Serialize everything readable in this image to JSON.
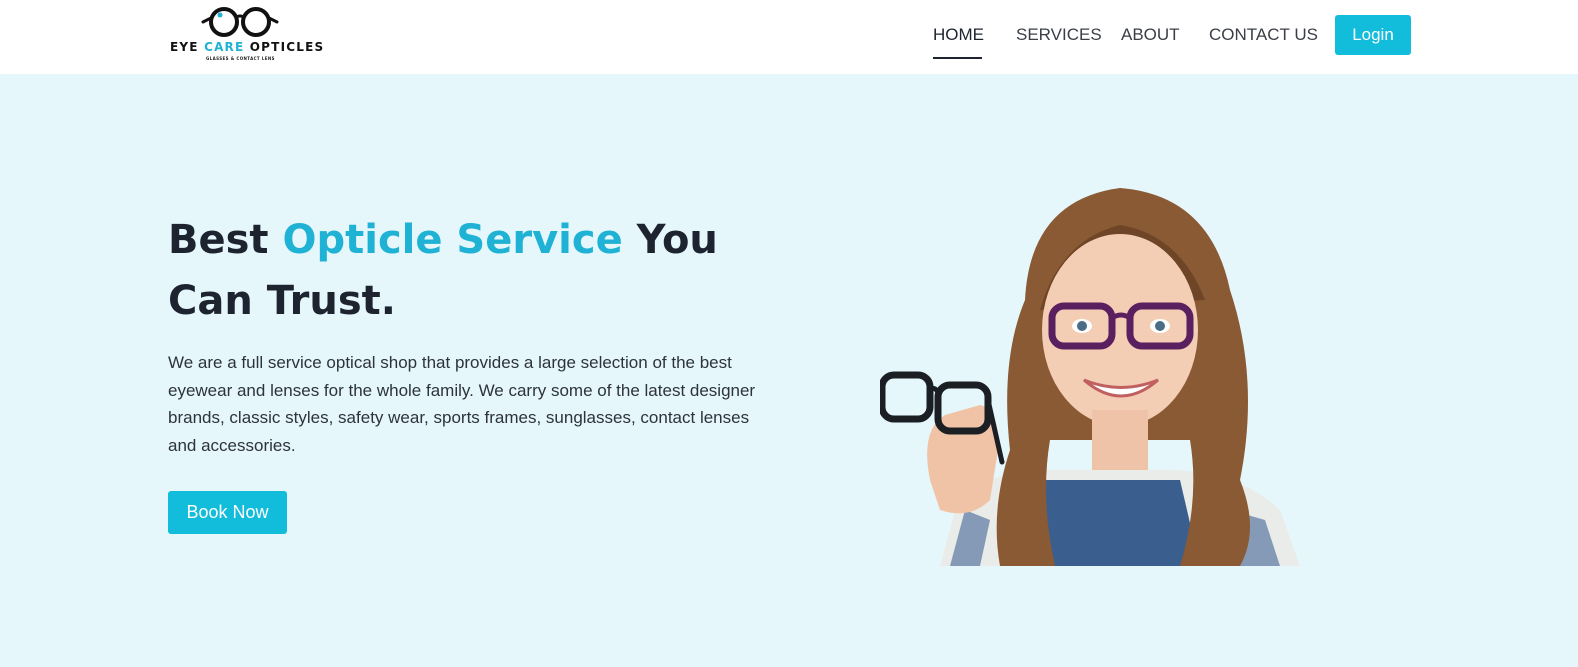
{
  "header": {
    "logo": {
      "name_part1": "EYE ",
      "name_accent": "CARE",
      "name_part2": " OPTICLES",
      "tagline": "GLASSES & CONTACT LENS"
    },
    "nav": [
      {
        "label": "HOME",
        "active": true
      },
      {
        "label": "SERVICES",
        "active": false
      },
      {
        "label": "ABOUT",
        "active": false
      },
      {
        "label": "CONTACT US",
        "active": false
      }
    ],
    "login_label": "Login"
  },
  "hero": {
    "title_part1": "Best ",
    "title_highlight": "Opticle Service",
    "title_part2": " You Can Trust.",
    "description": "We are a full service optical shop that provides a large selection of the best eyewear and lenses for the whole family. We carry some of the latest designer brands, classic styles, safety wear, sports frames, sunglasses, contact lenses and accessories.",
    "cta_label": "Book Now",
    "image_subject": "smiling girl in purple glasses holding black eyeglasses"
  },
  "colors": {
    "accent": "#12bcdb",
    "highlight_text": "#1fb2d4",
    "hero_background": "#e6f7fc",
    "header_background": "#ffffff",
    "heading": "#1d2430"
  },
  "icons": {
    "logo": "eyeglasses-logo-icon"
  }
}
